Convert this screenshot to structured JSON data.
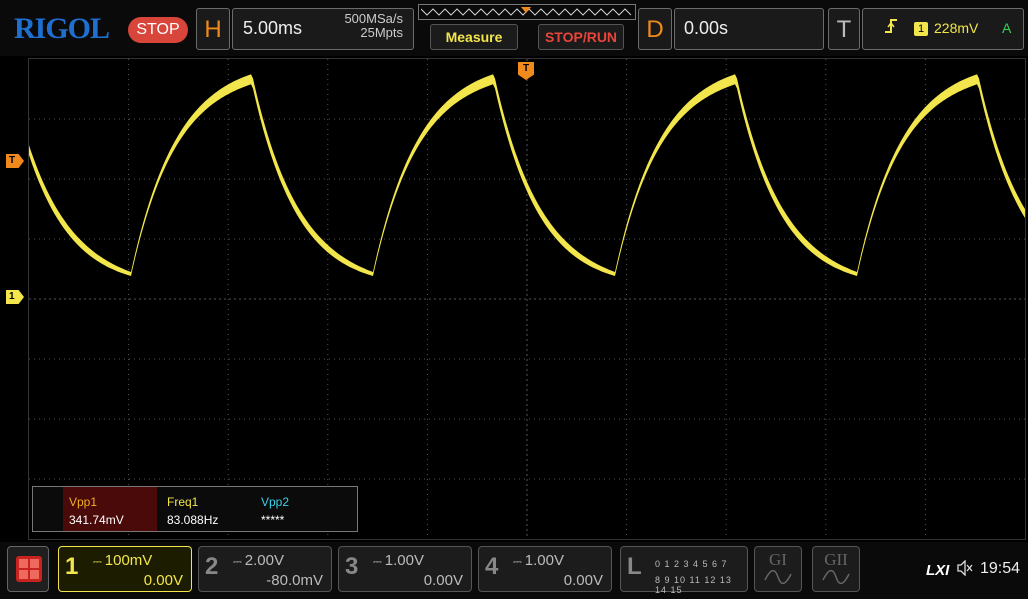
{
  "header": {
    "brand": "RIGOL",
    "run_state": "STOP",
    "horizontal": {
      "letter": "H",
      "timebase": "5.00ms",
      "sample_rate": "500MSa/s",
      "memory_depth": "25Mpts"
    },
    "measure_label": "Measure",
    "stop_run_label": "STOP/RUN",
    "delay": {
      "letter": "D",
      "value": "0.00s"
    },
    "trigger": {
      "letter": "T",
      "edge_icon": "rising-edge-icon",
      "channel": "1",
      "level": "228mV",
      "mode": "A"
    }
  },
  "screen": {
    "trigger_level_marker": "T",
    "channel1_marker": "1",
    "trigger_position_marker": "T",
    "colors": {
      "ch1": "#f2e64c",
      "trigger": "#f08a1c",
      "grid": "#555555"
    }
  },
  "measurements": [
    {
      "name": "Vpp1",
      "value": "341.74mV"
    },
    {
      "name": "Freq1",
      "value": "83.088Hz"
    },
    {
      "name": "Vpp2",
      "value": "*****"
    }
  ],
  "channels": [
    {
      "num": "1",
      "scale": "100mV",
      "offset": "0.00V",
      "active": true
    },
    {
      "num": "2",
      "scale": "2.00V",
      "offset": "-80.0mV",
      "active": false
    },
    {
      "num": "3",
      "scale": "1.00V",
      "offset": "0.00V",
      "active": false
    },
    {
      "num": "4",
      "scale": "1.00V",
      "offset": "0.00V",
      "active": false
    }
  ],
  "logic_analyzer": {
    "letter": "L",
    "row1": "0 1 2 3  4 5 6 7",
    "row2": "8 9 10 11 12 13 14 15"
  },
  "generators": [
    {
      "name": "GI"
    },
    {
      "name": "GII"
    }
  ],
  "status": {
    "lxi": "LXI",
    "sound_icon": "muted-speaker-icon",
    "time": "19:54"
  }
}
